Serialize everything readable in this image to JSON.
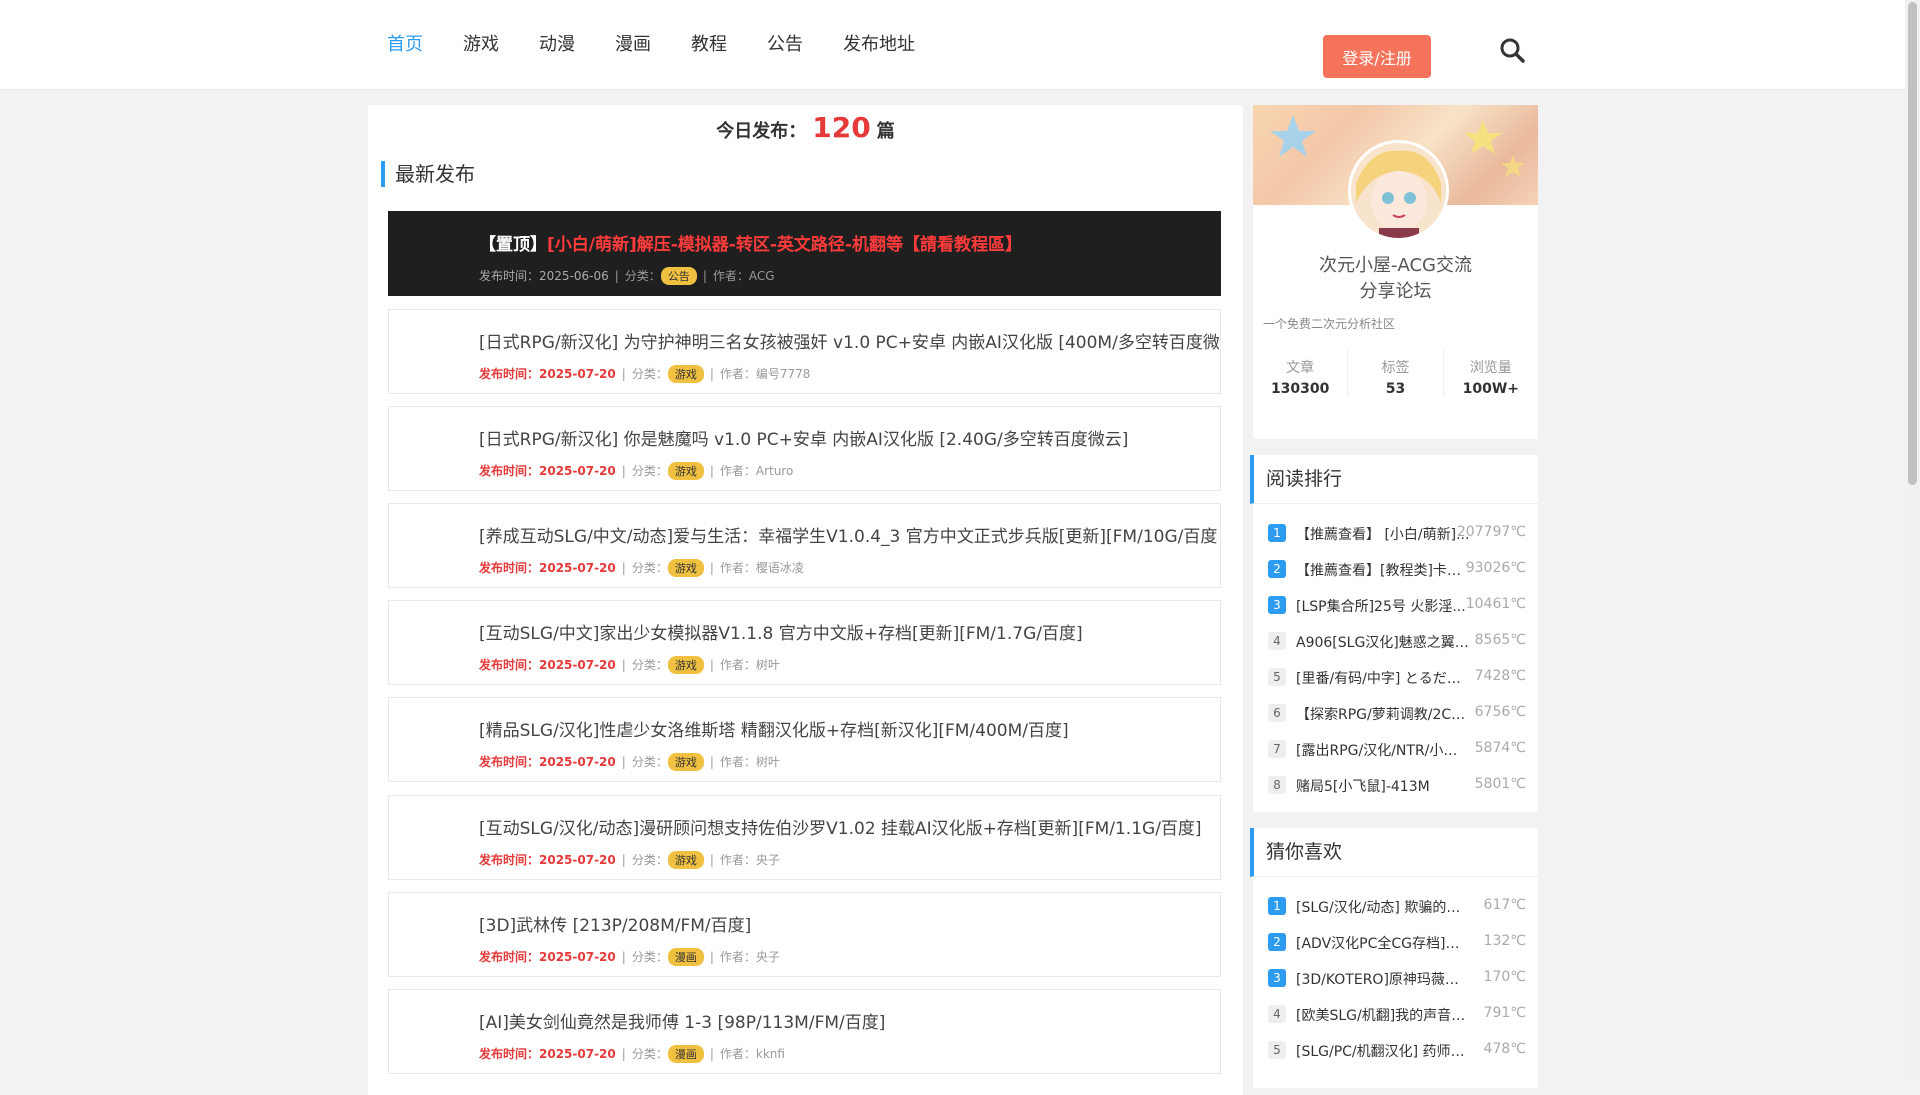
{
  "nav": {
    "items": [
      "首页",
      "游戏",
      "动漫",
      "漫画",
      "教程",
      "公告",
      "发布地址"
    ],
    "active": "首页"
  },
  "header": {
    "login_label": "登录/注册",
    "search_icon": "search-icon"
  },
  "today": {
    "label": "今日发布：",
    "count": "120",
    "unit": "篇"
  },
  "latest": {
    "title": "最新发布",
    "posts": [
      {
        "sticky": true,
        "tag": "【置顶】",
        "title": "[小白/萌新]解压-模拟器-转区-英文路径-机翻等【請看教程區】",
        "date": "发布时间：2025-06-06",
        "category_label": "分类：",
        "category": "公告",
        "author": "作者：ACG"
      },
      {
        "title": "[日式RPG/新汉化] 为守护神明三名女孩被强奸 v1.0 PC+安卓 内嵌AI汉化版 [400M/多空转百度微",
        "date": "发布时间：2025-07-20",
        "category_label": "分类：",
        "category": "游戏",
        "author": "作者：编号7778"
      },
      {
        "title": "[日式RPG/新汉化] 你是魅魔吗 v1.0 PC+安卓 内嵌AI汉化版 [2.40G/多空转百度微云]",
        "date": "发布时间：2025-07-20",
        "category_label": "分类：",
        "category": "游戏",
        "author": "作者：Arturo"
      },
      {
        "title": "[养成互动SLG/中文/动态]爱与生活：幸福学生V1.0.4_3 官方中文正式步兵版[更新][FM/10G/百度]",
        "date": "发布时间：2025-07-20",
        "category_label": "分类：",
        "category": "游戏",
        "author": "作者：樱语冰凌"
      },
      {
        "title": "[互动SLG/中文]家出少女模拟器V1.1.8 官方中文版+存档[更新][FM/1.7G/百度]",
        "date": "发布时间：2025-07-20",
        "category_label": "分类：",
        "category": "游戏",
        "author": "作者：树叶"
      },
      {
        "title": "[精品SLG/汉化]性虐少女洛维斯塔 精翻汉化版+存档[新汉化][FM/400M/百度]",
        "date": "发布时间：2025-07-20",
        "category_label": "分类：",
        "category": "游戏",
        "author": "作者：树叶"
      },
      {
        "title": "[互动SLG/汉化/动态]漫研顾问想支持佐伯沙罗V1.02 挂载AI汉化版+存档[更新][FM/1.1G/百度]",
        "date": "发布时间：2025-07-20",
        "category_label": "分类：",
        "category": "游戏",
        "author": "作者：央子"
      },
      {
        "title": "[3D]武林传 [213P/208M/FM/百度]",
        "date": "发布时间：2025-07-20",
        "category_label": "分类：",
        "category": "漫画",
        "author": "作者：央子"
      },
      {
        "title": "[AI]美女剑仙竟然是我师傅 1-3 [98P/113M/FM/百度]",
        "date": "发布时间：2025-07-20",
        "category_label": "分类：",
        "category": "漫画",
        "author": "作者：kknfi"
      }
    ]
  },
  "profile": {
    "name": "次元小屋-ACG交流分享论坛",
    "desc": "一个免费二次元分析社区",
    "stats": [
      {
        "label": "文章",
        "value": "130300"
      },
      {
        "label": "标签",
        "value": "53"
      },
      {
        "label": "浏览量",
        "value": "100W+"
      }
    ]
  },
  "reading_rank": {
    "title": "阅读排行",
    "items": [
      {
        "n": "1",
        "title": "【推薦查看】 [小白/萌新]...",
        "count": "207797℃"
      },
      {
        "n": "2",
        "title": "【推薦查看】[教程类]卡密...",
        "count": "93026℃"
      },
      {
        "n": "3",
        "title": "[LSP集合所]25号 火影淫...",
        "count": "10461℃"
      },
      {
        "n": "4",
        "title": "A906[SLG汉化]魅惑之翼：...",
        "count": "8565℃"
      },
      {
        "n": "5",
        "title": "[里番/有码/中字] とるだ屋...",
        "count": "7428℃"
      },
      {
        "n": "6",
        "title": "【探索RPG/萝莉调教/2C】 ...",
        "count": "6756℃"
      },
      {
        "n": "7",
        "title": "[露出RPG/汉化/NTR/小马...",
        "count": "5874℃"
      },
      {
        "n": "8",
        "title": "赌局5[小飞鼠]-413M",
        "count": "5801℃"
      }
    ]
  },
  "guess": {
    "title": "猜你喜欢",
    "items": [
      {
        "n": "1",
        "title": "[SLG/汉化/动态] 欺骗的阴影...",
        "count": "617℃"
      },
      {
        "n": "2",
        "title": "[ADV汉化PC全CG存档]天空...",
        "count": "132℃"
      },
      {
        "n": "3",
        "title": "[3D/KOTERO]原神玛薇卡-...",
        "count": "170℃"
      },
      {
        "n": "4",
        "title": "[欧美SLG/机翻]我的声音的...",
        "count": "791℃"
      },
      {
        "n": "5",
        "title": "[SLG/PC/机翻汉化] 药师兄...",
        "count": "478℃"
      }
    ]
  },
  "colors": {
    "accent": "#2d9cf0",
    "login": "#f6735b",
    "hot": "#e63a3a",
    "cat_badge": "#f0c040"
  }
}
